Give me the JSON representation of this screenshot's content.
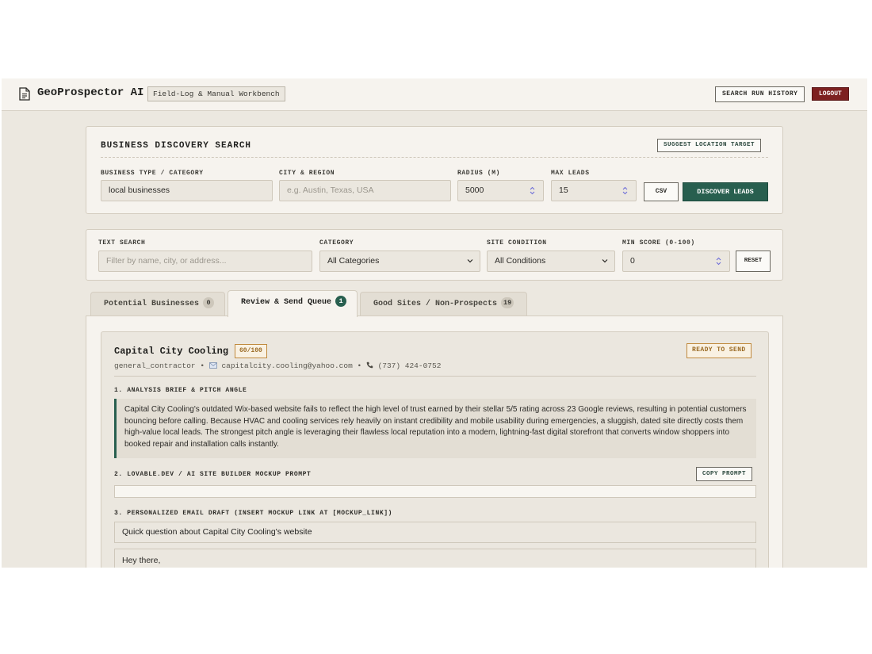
{
  "header": {
    "app_title": "GeoProspector AI",
    "workbench_label": "Field-Log & Manual Workbench",
    "history_button": "SEARCH RUN HISTORY",
    "logout_button": "LOGOUT"
  },
  "discovery": {
    "title": "BUSINESS DISCOVERY SEARCH",
    "suggest_button": "SUGGEST LOCATION TARGET",
    "business_type_label": "BUSINESS TYPE / CATEGORY",
    "business_type_value": "local businesses",
    "city_label": "CITY & REGION",
    "city_placeholder": "e.g. Austin, Texas, USA",
    "radius_label": "RADIUS (M)",
    "radius_value": "5000",
    "max_leads_label": "MAX LEADS",
    "max_leads_value": "15",
    "csv_button": "CSV",
    "discover_button": "DISCOVER LEADS"
  },
  "filters": {
    "text_search_label": "TEXT SEARCH",
    "text_search_placeholder": "Filter by name, city, or address...",
    "category_label": "CATEGORY",
    "category_value": "All Categories",
    "site_condition_label": "SITE CONDITION",
    "site_condition_value": "All Conditions",
    "min_score_label": "MIN SCORE (0-100)",
    "min_score_value": "0",
    "reset_button": "RESET"
  },
  "tabs": [
    {
      "label": "Potential Businesses",
      "count": "0",
      "active": false
    },
    {
      "label": "Review & Send Queue",
      "count": "1",
      "active": true
    },
    {
      "label": "Good Sites / Non-Prospects",
      "count": "19",
      "active": false
    }
  ],
  "lead": {
    "name": "Capital City Cooling",
    "score": "60/100",
    "status": "READY TO SEND",
    "category": "general_contractor",
    "separator": "•",
    "email": "capitalcity.cooling@yahoo.com",
    "phone": "(737) 424-0752",
    "section1_label": "1. ANALYSIS BRIEF & PITCH ANGLE",
    "brief": "Capital City Cooling's outdated Wix-based website fails to reflect the high level of trust earned by their stellar 5/5 rating across 23 Google reviews, resulting in potential customers bouncing before calling. Because HVAC and cooling services rely heavily on instant credibility and mobile usability during emergencies, a sluggish, dated site directly costs them high-value local leads. The strongest pitch angle is leveraging their flawless local reputation into a modern, lightning-fast digital storefront that converts window shoppers into booked repair and installation calls instantly.",
    "section2_label": "2. LOVABLE.DEV / AI SITE BUILDER MOCKUP PROMPT",
    "copy_button": "COPY PROMPT",
    "prompt_text": "",
    "section3_label": "3. PERSONALIZED EMAIL DRAFT (INSERT MOCKUP LINK AT [MOCKUP_LINK])",
    "email_subject": "Quick question about Capital City Cooling's website",
    "email_body": "Hey there,"
  },
  "colors": {
    "accent_green": "#285f4f",
    "logout_red": "#7d2020",
    "badge_amber": "#c08a3e",
    "background": "#ece8e0"
  }
}
